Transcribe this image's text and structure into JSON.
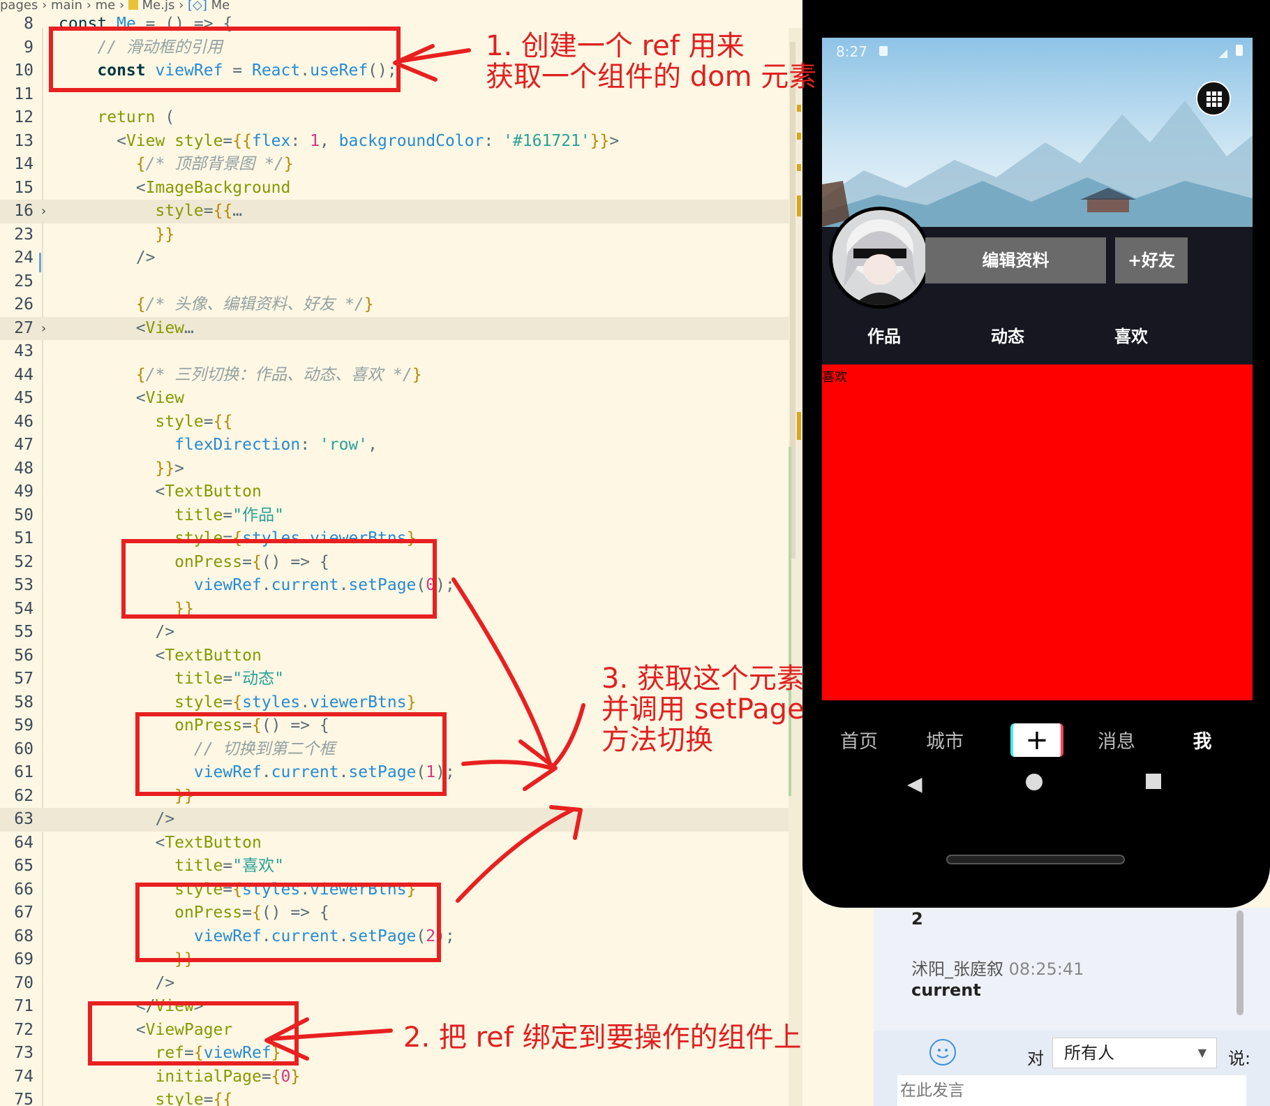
{
  "breadcrumb": {
    "parts": [
      "pages",
      "main",
      "me",
      "Me.js",
      "Me"
    ]
  },
  "code": {
    "lines": [
      {
        "n": "8",
        "hl": false,
        "fold": false,
        "tokens": [
          {
            "c": "dk",
            "t": "const "
          },
          {
            "c": "vr",
            "t": "Me"
          },
          {
            "c": "pl",
            "t": " = () => {"
          }
        ]
      },
      {
        "n": "9",
        "hl": false,
        "fold": false,
        "tokens": [
          {
            "c": "cm",
            "t": "    // 滑动框的引用"
          }
        ]
      },
      {
        "n": "10",
        "hl": false,
        "fold": false,
        "tokens": [
          {
            "c": "kw",
            "t": "    const "
          },
          {
            "c": "vr",
            "t": "viewRef"
          },
          {
            "c": "pl",
            "t": " = "
          },
          {
            "c": "vr",
            "t": "React"
          },
          {
            "c": "pl",
            "t": "."
          },
          {
            "c": "vr",
            "t": "useRef"
          },
          {
            "c": "pl",
            "t": "();"
          }
        ]
      },
      {
        "n": "11",
        "hl": false,
        "fold": false,
        "tokens": []
      },
      {
        "n": "12",
        "hl": false,
        "fold": false,
        "tokens": [
          {
            "c": "tg",
            "t": "    return"
          },
          {
            "c": "pl",
            "t": " ("
          }
        ]
      },
      {
        "n": "13",
        "hl": false,
        "fold": false,
        "tokens": [
          {
            "c": "pl",
            "t": "      <"
          },
          {
            "c": "tg",
            "t": "View"
          },
          {
            "c": "tg",
            "t": " style"
          },
          {
            "c": "pl",
            "t": "="
          },
          {
            "c": "br",
            "t": "{{"
          },
          {
            "c": "vr",
            "t": "flex"
          },
          {
            "c": "pl",
            "t": ": "
          },
          {
            "c": "nm",
            "t": "1"
          },
          {
            "c": "pl",
            "t": ", "
          },
          {
            "c": "vr",
            "t": "backgroundColor"
          },
          {
            "c": "pl",
            "t": ": "
          },
          {
            "c": "st",
            "t": "'#161721'"
          },
          {
            "c": "br",
            "t": "}}"
          },
          {
            "c": "pl",
            "t": ">"
          }
        ]
      },
      {
        "n": "14",
        "hl": false,
        "fold": false,
        "tokens": [
          {
            "c": "br",
            "t": "        {"
          },
          {
            "c": "cm",
            "t": "/* 顶部背景图 */"
          },
          {
            "c": "br",
            "t": "}"
          }
        ]
      },
      {
        "n": "15",
        "hl": false,
        "fold": false,
        "tokens": [
          {
            "c": "pl",
            "t": "        <"
          },
          {
            "c": "tg",
            "t": "ImageBackground"
          }
        ]
      },
      {
        "n": "16",
        "hl": true,
        "fold": true,
        "tokens": [
          {
            "c": "tg",
            "t": "          style"
          },
          {
            "c": "pl",
            "t": "="
          },
          {
            "c": "br",
            "t": "{{"
          },
          {
            "c": "pl",
            "t": "…"
          }
        ]
      },
      {
        "n": "23",
        "hl": false,
        "fold": false,
        "tokens": [
          {
            "c": "br",
            "t": "          }}"
          }
        ]
      },
      {
        "n": "24",
        "hl": false,
        "fold": false,
        "tokens": [
          {
            "c": "pl",
            "t": "        />"
          }
        ]
      },
      {
        "n": "25",
        "hl": false,
        "fold": false,
        "tokens": []
      },
      {
        "n": "26",
        "hl": false,
        "fold": false,
        "tokens": [
          {
            "c": "br",
            "t": "        {"
          },
          {
            "c": "cm",
            "t": "/* 头像、编辑资料、好友 */"
          },
          {
            "c": "br",
            "t": "}"
          }
        ]
      },
      {
        "n": "27",
        "hl": true,
        "fold": true,
        "tokens": [
          {
            "c": "pl",
            "t": "        <"
          },
          {
            "c": "tg",
            "t": "View"
          },
          {
            "c": "pl",
            "t": "…"
          }
        ]
      },
      {
        "n": "43",
        "hl": false,
        "fold": false,
        "tokens": []
      },
      {
        "n": "44",
        "hl": false,
        "fold": false,
        "tokens": [
          {
            "c": "br",
            "t": "        {"
          },
          {
            "c": "cm",
            "t": "/* 三列切换：作品、动态、喜欢 */"
          },
          {
            "c": "br",
            "t": "}"
          }
        ]
      },
      {
        "n": "45",
        "hl": false,
        "fold": false,
        "tokens": [
          {
            "c": "pl",
            "t": "        <"
          },
          {
            "c": "tg",
            "t": "View"
          }
        ]
      },
      {
        "n": "46",
        "hl": false,
        "fold": false,
        "tokens": [
          {
            "c": "tg",
            "t": "          style"
          },
          {
            "c": "pl",
            "t": "="
          },
          {
            "c": "br",
            "t": "{{"
          }
        ]
      },
      {
        "n": "47",
        "hl": false,
        "fold": false,
        "tokens": [
          {
            "c": "vr",
            "t": "            flexDirection"
          },
          {
            "c": "pl",
            "t": ": "
          },
          {
            "c": "st",
            "t": "'row'"
          },
          {
            "c": "pl",
            "t": ","
          }
        ]
      },
      {
        "n": "48",
        "hl": false,
        "fold": false,
        "tokens": [
          {
            "c": "br",
            "t": "          }}"
          },
          {
            "c": "pl",
            "t": ">"
          }
        ]
      },
      {
        "n": "49",
        "hl": false,
        "fold": false,
        "tokens": [
          {
            "c": "pl",
            "t": "          <"
          },
          {
            "c": "tg",
            "t": "TextButton"
          }
        ]
      },
      {
        "n": "50",
        "hl": false,
        "fold": false,
        "tokens": [
          {
            "c": "tg",
            "t": "            title"
          },
          {
            "c": "pl",
            "t": "="
          },
          {
            "c": "st",
            "t": "\"作品\""
          }
        ]
      },
      {
        "n": "51",
        "hl": false,
        "fold": false,
        "tokens": [
          {
            "c": "tg",
            "t": "            style"
          },
          {
            "c": "pl",
            "t": "="
          },
          {
            "c": "br",
            "t": "{"
          },
          {
            "c": "vr",
            "t": "styles"
          },
          {
            "c": "pl",
            "t": "."
          },
          {
            "c": "vr",
            "t": "viewerBtns"
          },
          {
            "c": "br",
            "t": "}"
          }
        ]
      },
      {
        "n": "52",
        "hl": false,
        "fold": false,
        "tokens": [
          {
            "c": "tg",
            "t": "            onPress"
          },
          {
            "c": "pl",
            "t": "="
          },
          {
            "c": "br",
            "t": "{"
          },
          {
            "c": "pl",
            "t": "() => {"
          }
        ]
      },
      {
        "n": "53",
        "hl": false,
        "fold": false,
        "tokens": [
          {
            "c": "vr",
            "t": "              viewRef"
          },
          {
            "c": "pl",
            "t": "."
          },
          {
            "c": "vr",
            "t": "current"
          },
          {
            "c": "pl",
            "t": "."
          },
          {
            "c": "vr",
            "t": "setPage"
          },
          {
            "c": "pl",
            "t": "("
          },
          {
            "c": "nm",
            "t": "0"
          },
          {
            "c": "pl",
            "t": ");"
          }
        ]
      },
      {
        "n": "54",
        "hl": false,
        "fold": false,
        "tokens": [
          {
            "c": "br",
            "t": "            }}"
          }
        ]
      },
      {
        "n": "55",
        "hl": false,
        "fold": false,
        "tokens": [
          {
            "c": "pl",
            "t": "          />"
          }
        ]
      },
      {
        "n": "56",
        "hl": false,
        "fold": false,
        "tokens": [
          {
            "c": "pl",
            "t": "          <"
          },
          {
            "c": "tg",
            "t": "TextButton"
          }
        ]
      },
      {
        "n": "57",
        "hl": false,
        "fold": false,
        "tokens": [
          {
            "c": "tg",
            "t": "            title"
          },
          {
            "c": "pl",
            "t": "="
          },
          {
            "c": "st",
            "t": "\"动态\""
          }
        ]
      },
      {
        "n": "58",
        "hl": false,
        "fold": false,
        "tokens": [
          {
            "c": "tg",
            "t": "            style"
          },
          {
            "c": "pl",
            "t": "="
          },
          {
            "c": "br",
            "t": "{"
          },
          {
            "c": "vr",
            "t": "styles"
          },
          {
            "c": "pl",
            "t": "."
          },
          {
            "c": "vr",
            "t": "viewerBtns"
          },
          {
            "c": "br",
            "t": "}"
          }
        ]
      },
      {
        "n": "59",
        "hl": false,
        "fold": false,
        "tokens": [
          {
            "c": "tg",
            "t": "            onPress"
          },
          {
            "c": "pl",
            "t": "="
          },
          {
            "c": "br",
            "t": "{"
          },
          {
            "c": "pl",
            "t": "() => {"
          }
        ]
      },
      {
        "n": "60",
        "hl": false,
        "fold": false,
        "tokens": [
          {
            "c": "cm",
            "t": "              // 切换到第二个框"
          }
        ]
      },
      {
        "n": "61",
        "hl": false,
        "fold": false,
        "tokens": [
          {
            "c": "vr",
            "t": "              viewRef"
          },
          {
            "c": "pl",
            "t": "."
          },
          {
            "c": "vr",
            "t": "current"
          },
          {
            "c": "pl",
            "t": "."
          },
          {
            "c": "vr",
            "t": "setPage"
          },
          {
            "c": "pl",
            "t": "("
          },
          {
            "c": "nm",
            "t": "1"
          },
          {
            "c": "pl",
            "t": ");"
          }
        ]
      },
      {
        "n": "62",
        "hl": false,
        "fold": false,
        "tokens": [
          {
            "c": "br",
            "t": "            }}"
          }
        ]
      },
      {
        "n": "63",
        "hl": true,
        "fold": false,
        "tokens": [
          {
            "c": "pl",
            "t": "          />"
          }
        ]
      },
      {
        "n": "64",
        "hl": false,
        "fold": false,
        "tokens": [
          {
            "c": "pl",
            "t": "          <"
          },
          {
            "c": "tg",
            "t": "TextButton"
          }
        ]
      },
      {
        "n": "65",
        "hl": false,
        "fold": false,
        "tokens": [
          {
            "c": "tg",
            "t": "            title"
          },
          {
            "c": "pl",
            "t": "="
          },
          {
            "c": "st",
            "t": "\"喜欢\""
          }
        ]
      },
      {
        "n": "66",
        "hl": false,
        "fold": false,
        "tokens": [
          {
            "c": "tg",
            "t": "            style"
          },
          {
            "c": "pl",
            "t": "="
          },
          {
            "c": "br",
            "t": "{"
          },
          {
            "c": "vr",
            "t": "styles"
          },
          {
            "c": "pl",
            "t": "."
          },
          {
            "c": "vr",
            "t": "viewerBtns"
          },
          {
            "c": "br",
            "t": "}"
          }
        ]
      },
      {
        "n": "67",
        "hl": false,
        "fold": false,
        "tokens": [
          {
            "c": "tg",
            "t": "            onPress"
          },
          {
            "c": "pl",
            "t": "="
          },
          {
            "c": "br",
            "t": "{"
          },
          {
            "c": "pl",
            "t": "() => {"
          }
        ]
      },
      {
        "n": "68",
        "hl": false,
        "fold": false,
        "tokens": [
          {
            "c": "vr",
            "t": "              viewRef"
          },
          {
            "c": "pl",
            "t": "."
          },
          {
            "c": "vr",
            "t": "current"
          },
          {
            "c": "pl",
            "t": "."
          },
          {
            "c": "vr",
            "t": "setPage"
          },
          {
            "c": "pl",
            "t": "("
          },
          {
            "c": "nm",
            "t": "2"
          },
          {
            "c": "pl",
            "t": ");"
          }
        ]
      },
      {
        "n": "69",
        "hl": false,
        "fold": false,
        "tokens": [
          {
            "c": "br",
            "t": "            }}"
          }
        ]
      },
      {
        "n": "70",
        "hl": false,
        "fold": false,
        "tokens": [
          {
            "c": "pl",
            "t": "          />"
          }
        ]
      },
      {
        "n": "71",
        "hl": false,
        "fold": false,
        "tokens": [
          {
            "c": "pl",
            "t": "        </"
          },
          {
            "c": "tg",
            "t": "View"
          },
          {
            "c": "pl",
            "t": ">"
          }
        ]
      },
      {
        "n": "72",
        "hl": false,
        "fold": false,
        "tokens": [
          {
            "c": "pl",
            "t": "        <"
          },
          {
            "c": "tg",
            "t": "ViewPager"
          }
        ]
      },
      {
        "n": "73",
        "hl": false,
        "fold": false,
        "tokens": [
          {
            "c": "tg",
            "t": "          ref"
          },
          {
            "c": "pl",
            "t": "="
          },
          {
            "c": "br",
            "t": "{"
          },
          {
            "c": "vr",
            "t": "viewRef"
          },
          {
            "c": "br",
            "t": "}"
          }
        ]
      },
      {
        "n": "74",
        "hl": false,
        "fold": false,
        "tokens": [
          {
            "c": "tg",
            "t": "          initialPage"
          },
          {
            "c": "pl",
            "t": "="
          },
          {
            "c": "br",
            "t": "{"
          },
          {
            "c": "nm",
            "t": "0"
          },
          {
            "c": "br",
            "t": "}"
          }
        ]
      },
      {
        "n": "75",
        "hl": false,
        "fold": false,
        "tokens": [
          {
            "c": "tg",
            "t": "          style"
          },
          {
            "c": "pl",
            "t": "="
          },
          {
            "c": "br",
            "t": "{{"
          }
        ]
      }
    ]
  },
  "annotations": {
    "note1_line1": "1. 创建一个 ref 用来",
    "note1_line2": "获取一个组件的 dom 元素",
    "note2": "2. 把 ref 绑定到要操作的组件上",
    "note3_line1": "3. 获取这个元素",
    "note3_line2": "并调用 setPage",
    "note3_line3": "方法切换",
    "color": "#e02020"
  },
  "phone": {
    "time": "8:27",
    "edit_profile": "编辑资料",
    "add_friend": "+好友",
    "tabs": [
      "作品",
      "动态",
      "喜欢"
    ],
    "page_label": "喜欢",
    "page_color": "#ff0000",
    "bg_color": "#161721",
    "bottom_nav": [
      "首页",
      "城市",
      "+",
      "消息",
      "我"
    ]
  },
  "chat": {
    "value_line": "2",
    "author": "沭阳_张庭叙",
    "time": "08:25:41",
    "message": "current",
    "to_label": "对",
    "recipient": "所有人",
    "say_label": "说:",
    "input_placeholder": "在此发言"
  }
}
